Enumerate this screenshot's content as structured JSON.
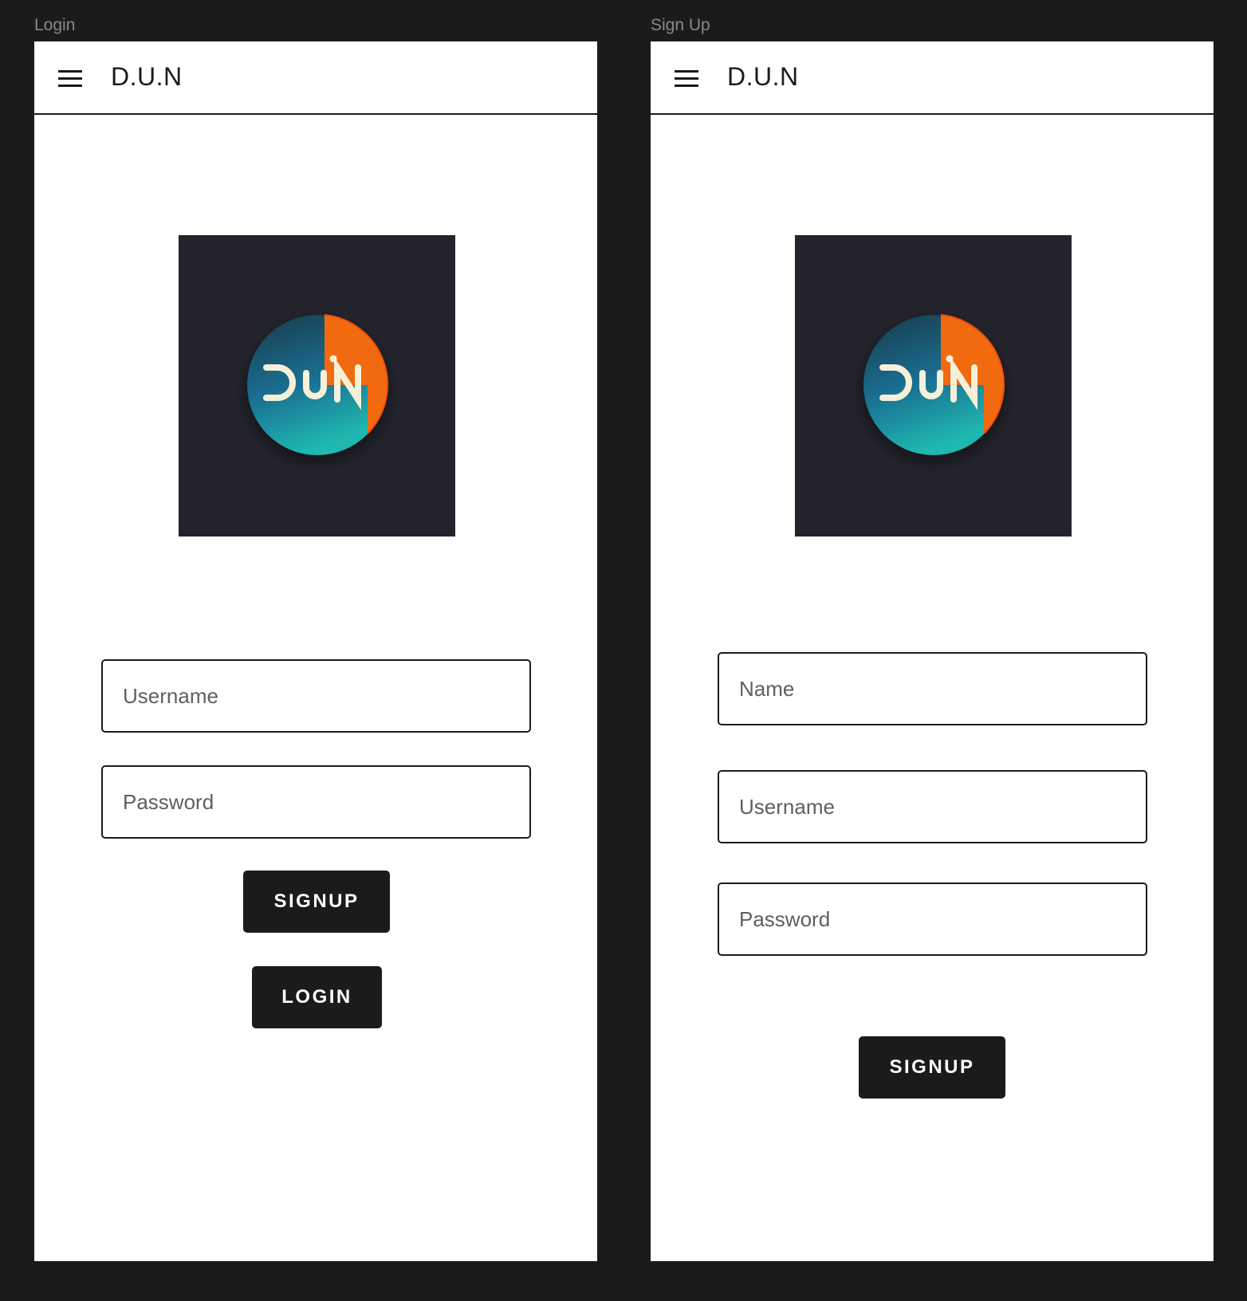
{
  "frames": {
    "login": {
      "label": "Login",
      "appbar": {
        "title": "D.U.N"
      },
      "fields": {
        "username_placeholder": "Username",
        "password_placeholder": "Password"
      },
      "buttons": {
        "signup": "SIGNUP",
        "login": "LOGIN"
      }
    },
    "signup": {
      "label": "Sign Up",
      "appbar": {
        "title": "D.U.N"
      },
      "fields": {
        "name_placeholder": "Name",
        "username_placeholder": "Username",
        "password_placeholder": "Password"
      },
      "buttons": {
        "signup": "SIGNUP"
      }
    }
  },
  "logo": {
    "text": "DUN",
    "colors": {
      "background": "#23232c",
      "ring_orange": "#f26a0f",
      "gradient_top": "#183948",
      "gradient_bottom": "#1fb8b0",
      "letters": "#f7f0d8"
    }
  },
  "icons": {
    "menu": "hamburger-menu-icon"
  }
}
